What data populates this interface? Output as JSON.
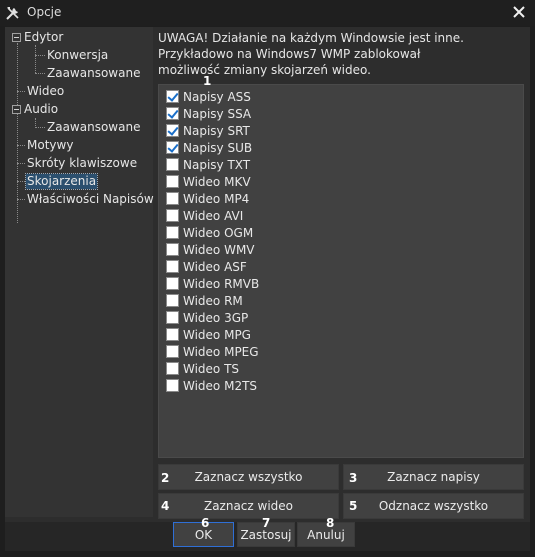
{
  "window": {
    "title": "Opcje"
  },
  "tree": {
    "items": [
      {
        "label": "Edytor"
      },
      {
        "label": "Konwersja"
      },
      {
        "label": "Zaawansowane"
      },
      {
        "label": "Wideo"
      },
      {
        "label": "Audio"
      },
      {
        "label": "Zaawansowane"
      },
      {
        "label": "Motywy"
      },
      {
        "label": "Skróty klawiszowe"
      },
      {
        "label": "Skojarzenia"
      },
      {
        "label": "Właściwości Napisów"
      }
    ]
  },
  "warning": {
    "line1": "UWAGA! Działanie na każdym Windowsie jest inne.",
    "line2": "Przykładowo na Windows7 WMP zablokował",
    "line3": "możliwość zmiany skojarzeń wideo."
  },
  "associations": [
    {
      "label": "Napisy ASS",
      "checked": true
    },
    {
      "label": "Napisy SSA",
      "checked": true
    },
    {
      "label": "Napisy SRT",
      "checked": true
    },
    {
      "label": "Napisy SUB",
      "checked": true
    },
    {
      "label": "Napisy TXT",
      "checked": false
    },
    {
      "label": "Wideo MKV",
      "checked": false
    },
    {
      "label": "Wideo MP4",
      "checked": false
    },
    {
      "label": "Wideo AVI",
      "checked": false
    },
    {
      "label": "Wideo OGM",
      "checked": false
    },
    {
      "label": "Wideo WMV",
      "checked": false
    },
    {
      "label": "Wideo ASF",
      "checked": false
    },
    {
      "label": "Wideo RMVB",
      "checked": false
    },
    {
      "label": "Wideo RM",
      "checked": false
    },
    {
      "label": "Wideo 3GP",
      "checked": false
    },
    {
      "label": "Wideo MPG",
      "checked": false
    },
    {
      "label": "Wideo MPEG",
      "checked": false
    },
    {
      "label": "Wideo TS",
      "checked": false
    },
    {
      "label": "Wideo M2TS",
      "checked": false
    }
  ],
  "buttons": {
    "select_all": "Zaznacz wszystko",
    "select_subtitles": "Zaznacz napisy",
    "select_video": "Zaznacz wideo",
    "deselect_all": "Odznacz wszystko",
    "ok": "OK",
    "apply": "Zastosuj",
    "cancel": "Anuluj"
  },
  "markers": [
    "1",
    "2",
    "3",
    "4",
    "5",
    "6",
    "7",
    "8"
  ],
  "colors": {
    "checkmark": "#1a6fc9",
    "ok_border": "#2f6fd6",
    "selected_bg": "#2b4f6e"
  }
}
